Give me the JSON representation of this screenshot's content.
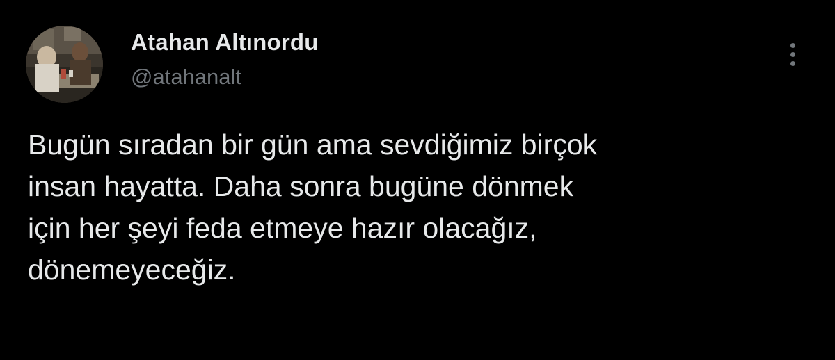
{
  "user": {
    "display_name": "Atahan Altınordu",
    "handle": "@atahanalt"
  },
  "tweet": {
    "lines": [
      "Bugün sıradan bir gün ama sevdiğimiz birçok",
      "insan hayatta. Daha sonra bugüne dönmek",
      "için her şeyi feda etmeye hazır olacağız,",
      "dönemeyeceğiz."
    ]
  },
  "icons": {
    "avatar": "profile-photo",
    "more": "more-options-icon"
  },
  "colors": {
    "background": "#000000",
    "text_primary": "#e7e9ea",
    "text_secondary": "#71767b"
  }
}
